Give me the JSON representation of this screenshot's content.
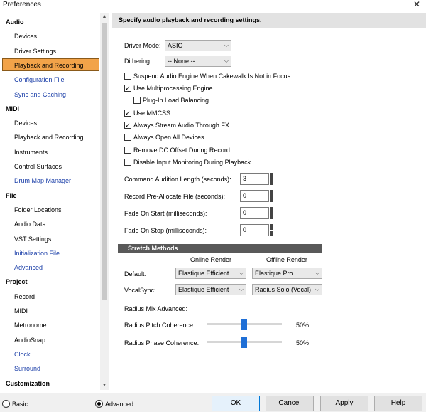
{
  "window": {
    "title": "Preferences",
    "close_glyph": "✕"
  },
  "sidebar": {
    "categories": [
      {
        "label": "Audio",
        "items": [
          {
            "label": "Devices"
          },
          {
            "label": "Driver Settings"
          },
          {
            "label": "Playback and Recording",
            "selected": true
          },
          {
            "label": "Configuration File",
            "link": true
          },
          {
            "label": "Sync and Caching",
            "link": true
          }
        ]
      },
      {
        "label": "MIDI",
        "items": [
          {
            "label": "Devices"
          },
          {
            "label": "Playback and Recording"
          },
          {
            "label": "Instruments"
          },
          {
            "label": "Control Surfaces"
          },
          {
            "label": "Drum Map Manager",
            "link": true
          }
        ]
      },
      {
        "label": "File",
        "items": [
          {
            "label": "Folder Locations"
          },
          {
            "label": "Audio Data"
          },
          {
            "label": "VST Settings"
          },
          {
            "label": "Initialization File",
            "link": true
          },
          {
            "label": "Advanced",
            "link": true
          }
        ]
      },
      {
        "label": "Project",
        "items": [
          {
            "label": "Record"
          },
          {
            "label": "MIDI"
          },
          {
            "label": "Metronome"
          },
          {
            "label": "AudioSnap"
          },
          {
            "label": "Clock",
            "link": true
          },
          {
            "label": "Surround",
            "link": true
          }
        ]
      },
      {
        "label": "Customization",
        "items": []
      }
    ]
  },
  "main": {
    "header": "Specify audio playback and recording settings.",
    "driver_mode_label": "Driver Mode:",
    "driver_mode_value": "ASIO",
    "dithering_label": "Dithering:",
    "dithering_value": "-- None --",
    "checkboxes": [
      {
        "label": "Suspend Audio Engine When Cakewalk Is Not in Focus",
        "checked": false,
        "indent": false
      },
      {
        "label": "Use Multiprocessing Engine",
        "checked": true,
        "indent": false
      },
      {
        "label": "Plug-In Load Balancing",
        "checked": false,
        "indent": true
      },
      {
        "label": "Use MMCSS",
        "checked": true,
        "indent": false
      },
      {
        "label": "Always Stream Audio Through FX",
        "checked": true,
        "indent": false
      },
      {
        "label": "Always Open All Devices",
        "checked": false,
        "indent": false
      },
      {
        "label": "Remove DC Offset During Record",
        "checked": false,
        "indent": false
      },
      {
        "label": "Disable Input Monitoring During Playback",
        "checked": false,
        "indent": false
      }
    ],
    "spinners": [
      {
        "label": "Command Audition Length (seconds):",
        "value": "3"
      },
      {
        "label": "Record Pre-Allocate File (seconds):",
        "value": "0"
      },
      {
        "label": "Fade On Start  (milliseconds):",
        "value": "0"
      },
      {
        "label": "Fade On Stop  (milliseconds):",
        "value": "0"
      }
    ],
    "stretch": {
      "title": "Stretch Methods",
      "online_header": "Online Render",
      "offline_header": "Offline Render",
      "rows": [
        {
          "label": "Default:",
          "online": "Elastique Efficient",
          "offline": "Elastique Pro"
        },
        {
          "label": "VocalSync:",
          "online": "Elastique Efficient",
          "offline": "Radius Solo (Vocal)"
        }
      ],
      "radius_mix_label": "Radius Mix Advanced:",
      "pitch_label": "Radius Pitch Coherence:",
      "pitch_value": "50%",
      "pitch_level": 0.5,
      "phase_label": "Radius Phase Coherence:",
      "phase_value": "50%",
      "phase_level": 0.5
    }
  },
  "footer": {
    "basic_label": "Basic",
    "advanced_label": "Advanced",
    "mode_selected": "Advanced",
    "ok": "OK",
    "cancel": "Cancel",
    "apply": "Apply",
    "help": "Help"
  }
}
